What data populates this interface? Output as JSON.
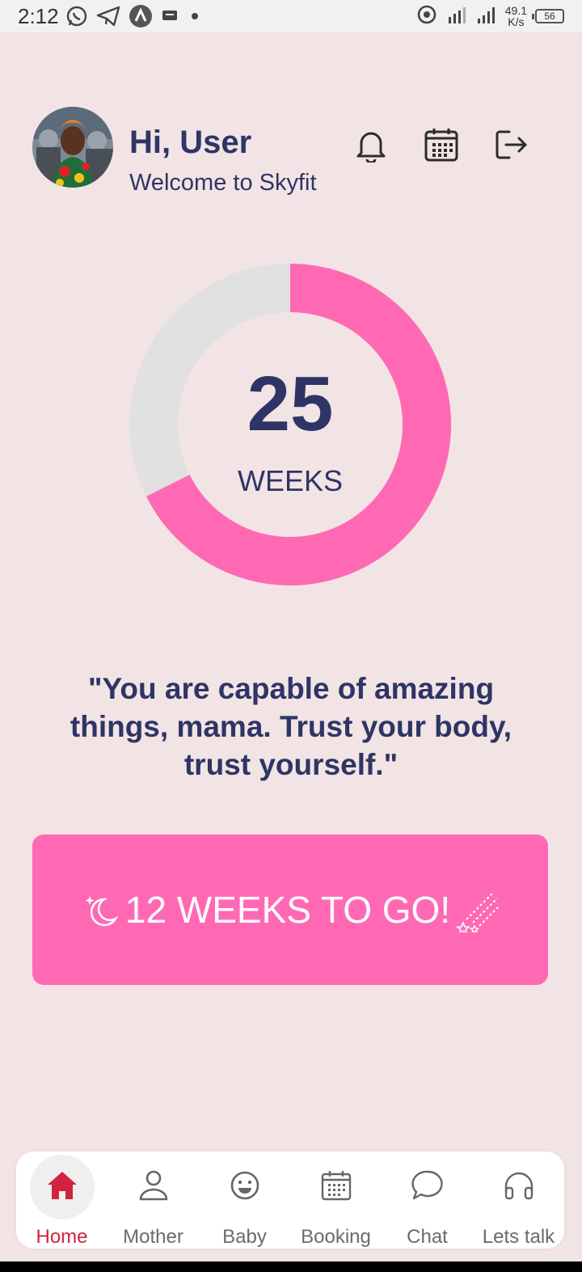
{
  "status_bar": {
    "time": "2:12",
    "net_speed_value": "49.1",
    "net_speed_unit": "K/s",
    "battery": "56"
  },
  "header": {
    "greeting": "Hi, User",
    "subtitle": "Welcome to Skyfit"
  },
  "progress": {
    "weeks": "25",
    "label": "WEEKS",
    "fraction": 0.676,
    "fill_color": "#ff69b4",
    "track_color": "#e1e1e1"
  },
  "quote": "\"You are capable of amazing things, mama. Trust your body, trust yourself.\"",
  "countdown": {
    "text": "12 WEEKS TO GO!",
    "background": "#ff69b4"
  },
  "nav": {
    "items": [
      {
        "label": "Home",
        "icon": "home-icon",
        "active": true
      },
      {
        "label": "Mother",
        "icon": "person-icon",
        "active": false
      },
      {
        "label": "Baby",
        "icon": "smiley-icon",
        "active": false
      },
      {
        "label": "Booking",
        "icon": "calendar-icon",
        "active": false
      },
      {
        "label": "Chat",
        "icon": "chat-bubble-icon",
        "active": false
      },
      {
        "label": "Lets talk",
        "icon": "headphones-icon",
        "active": false
      }
    ],
    "active_color": "#d0233f"
  },
  "colors": {
    "background": "#f2e4e4",
    "text_primary": "#2e3566",
    "accent": "#ff69b4"
  }
}
